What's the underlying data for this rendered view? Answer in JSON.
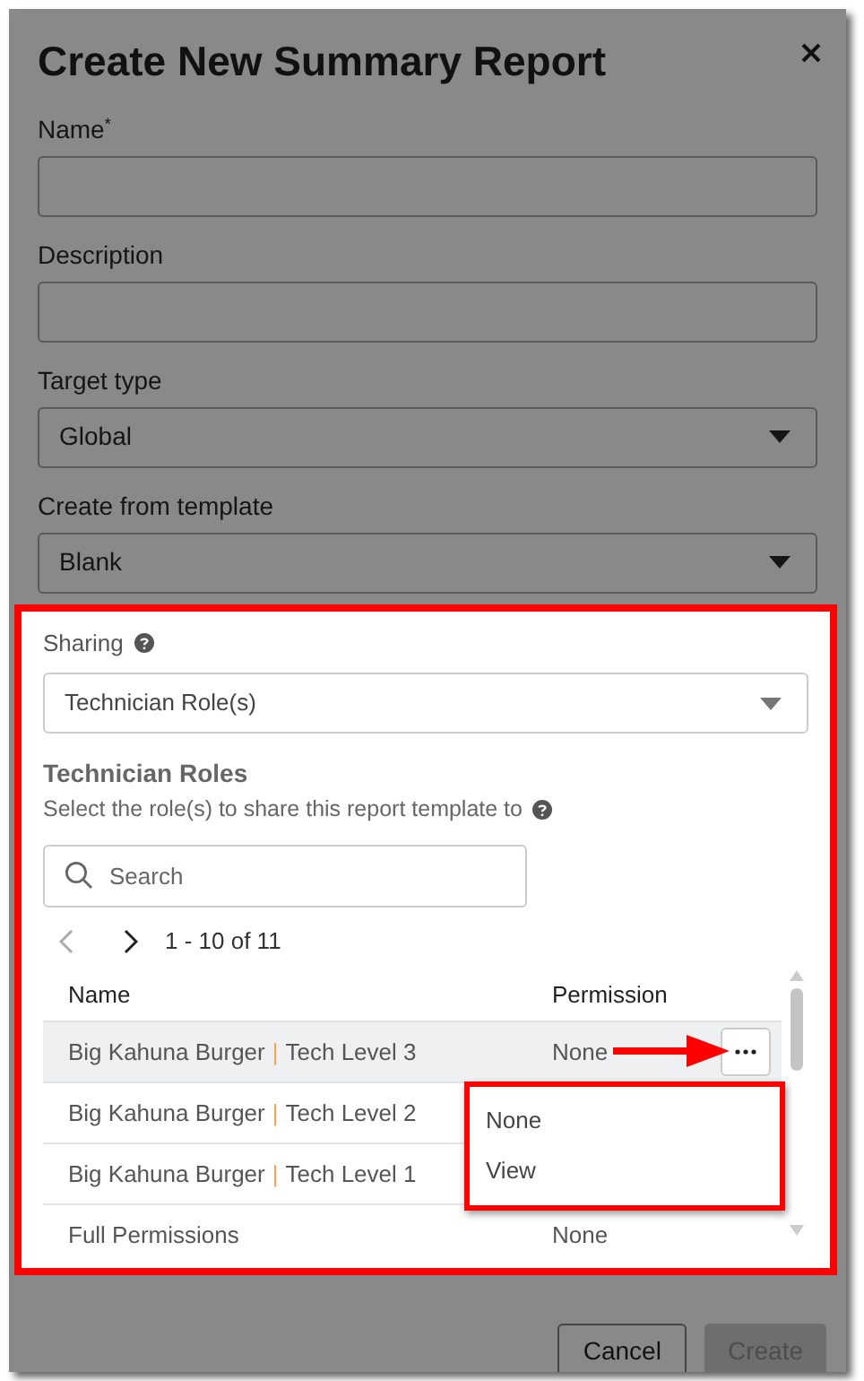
{
  "dialog": {
    "title": "Create New Summary Report",
    "fields": [
      {
        "kind": "input",
        "label": "Name",
        "required_mark": "*"
      },
      {
        "kind": "input",
        "label": "Description"
      },
      {
        "kind": "select",
        "label": "Target type",
        "value": "Global"
      },
      {
        "kind": "select",
        "label": "Create from template",
        "value": "Blank"
      }
    ],
    "sharing": {
      "label": "Sharing",
      "value": "Technician Role(s)"
    },
    "roles": {
      "heading": "Technician Roles",
      "hint": "Select the role(s) to share this report template to",
      "search": {
        "placeholder": "Search"
      },
      "pager": {
        "range": "1 - 10 of 11",
        "prev_disabled": true,
        "next_disabled": false
      },
      "columns": [
        "Name",
        "Permission"
      ],
      "rows": [
        {
          "org": "Big Kahuna Burger",
          "sep": "|",
          "role": "Tech Level 3",
          "permission": "None",
          "selected": true
        },
        {
          "org": "Big Kahuna Burger",
          "sep": "|",
          "role": "Tech Level 2",
          "selected": false
        },
        {
          "org": "Big Kahuna Burger",
          "sep": "|",
          "role": "Tech Level 1",
          "selected": false
        },
        {
          "org": "Full Permissions",
          "permission": "None",
          "selected": false
        }
      ],
      "menu": {
        "items": [
          "None",
          "View"
        ]
      }
    },
    "buttons": [
      {
        "label": "Cancel",
        "kind": "secondary",
        "disabled": false
      },
      {
        "label": "Create",
        "kind": "primary",
        "disabled": true
      }
    ]
  }
}
